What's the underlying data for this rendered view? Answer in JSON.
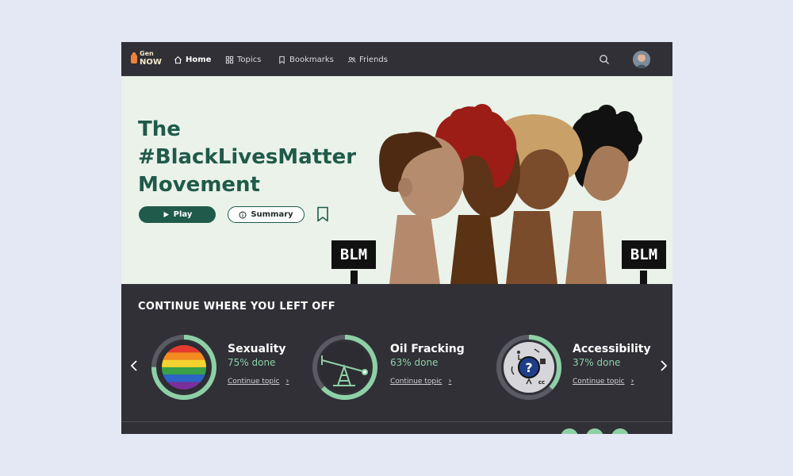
{
  "nav": {
    "logo_line1": "Gen",
    "logo_line2": "NOW",
    "items": [
      {
        "label": "Home",
        "icon": "home-icon",
        "active": true
      },
      {
        "label": "Topics",
        "icon": "grid-icon",
        "active": false
      },
      {
        "label": "Bookmarks",
        "icon": "bookmark-icon",
        "active": false
      },
      {
        "label": "Friends",
        "icon": "friends-icon",
        "active": false
      }
    ],
    "search_icon": "search-icon",
    "avatar_icon": "user-avatar"
  },
  "hero": {
    "title_lines": [
      "The",
      "#BlackLivesMatter",
      "Movement"
    ],
    "play_label": "Play",
    "summary_label": "Summary",
    "sign_text": "BLM"
  },
  "continue": {
    "heading": "CONTINUE WHERE YOU LEFT OFF",
    "cards": [
      {
        "title": "Sexuality",
        "progress_text": "75% done",
        "progress": 0.75,
        "link": "Continue topic",
        "image": "rainbow-flag-icon"
      },
      {
        "title": "Oil Fracking",
        "progress_text": "63% done",
        "progress": 0.63,
        "link": "Continue topic",
        "image": "oil-pump-icon"
      },
      {
        "title": "Accessibility",
        "progress_text": "37% done",
        "progress": 0.37,
        "link": "Continue topic",
        "image": "accessibility-icon"
      }
    ]
  },
  "colors": {
    "brand_dark": "#1f5a4a",
    "progress_green": "#8ed0a6",
    "hero_bg": "#eaf2ea",
    "panel_bg": "#303036"
  }
}
